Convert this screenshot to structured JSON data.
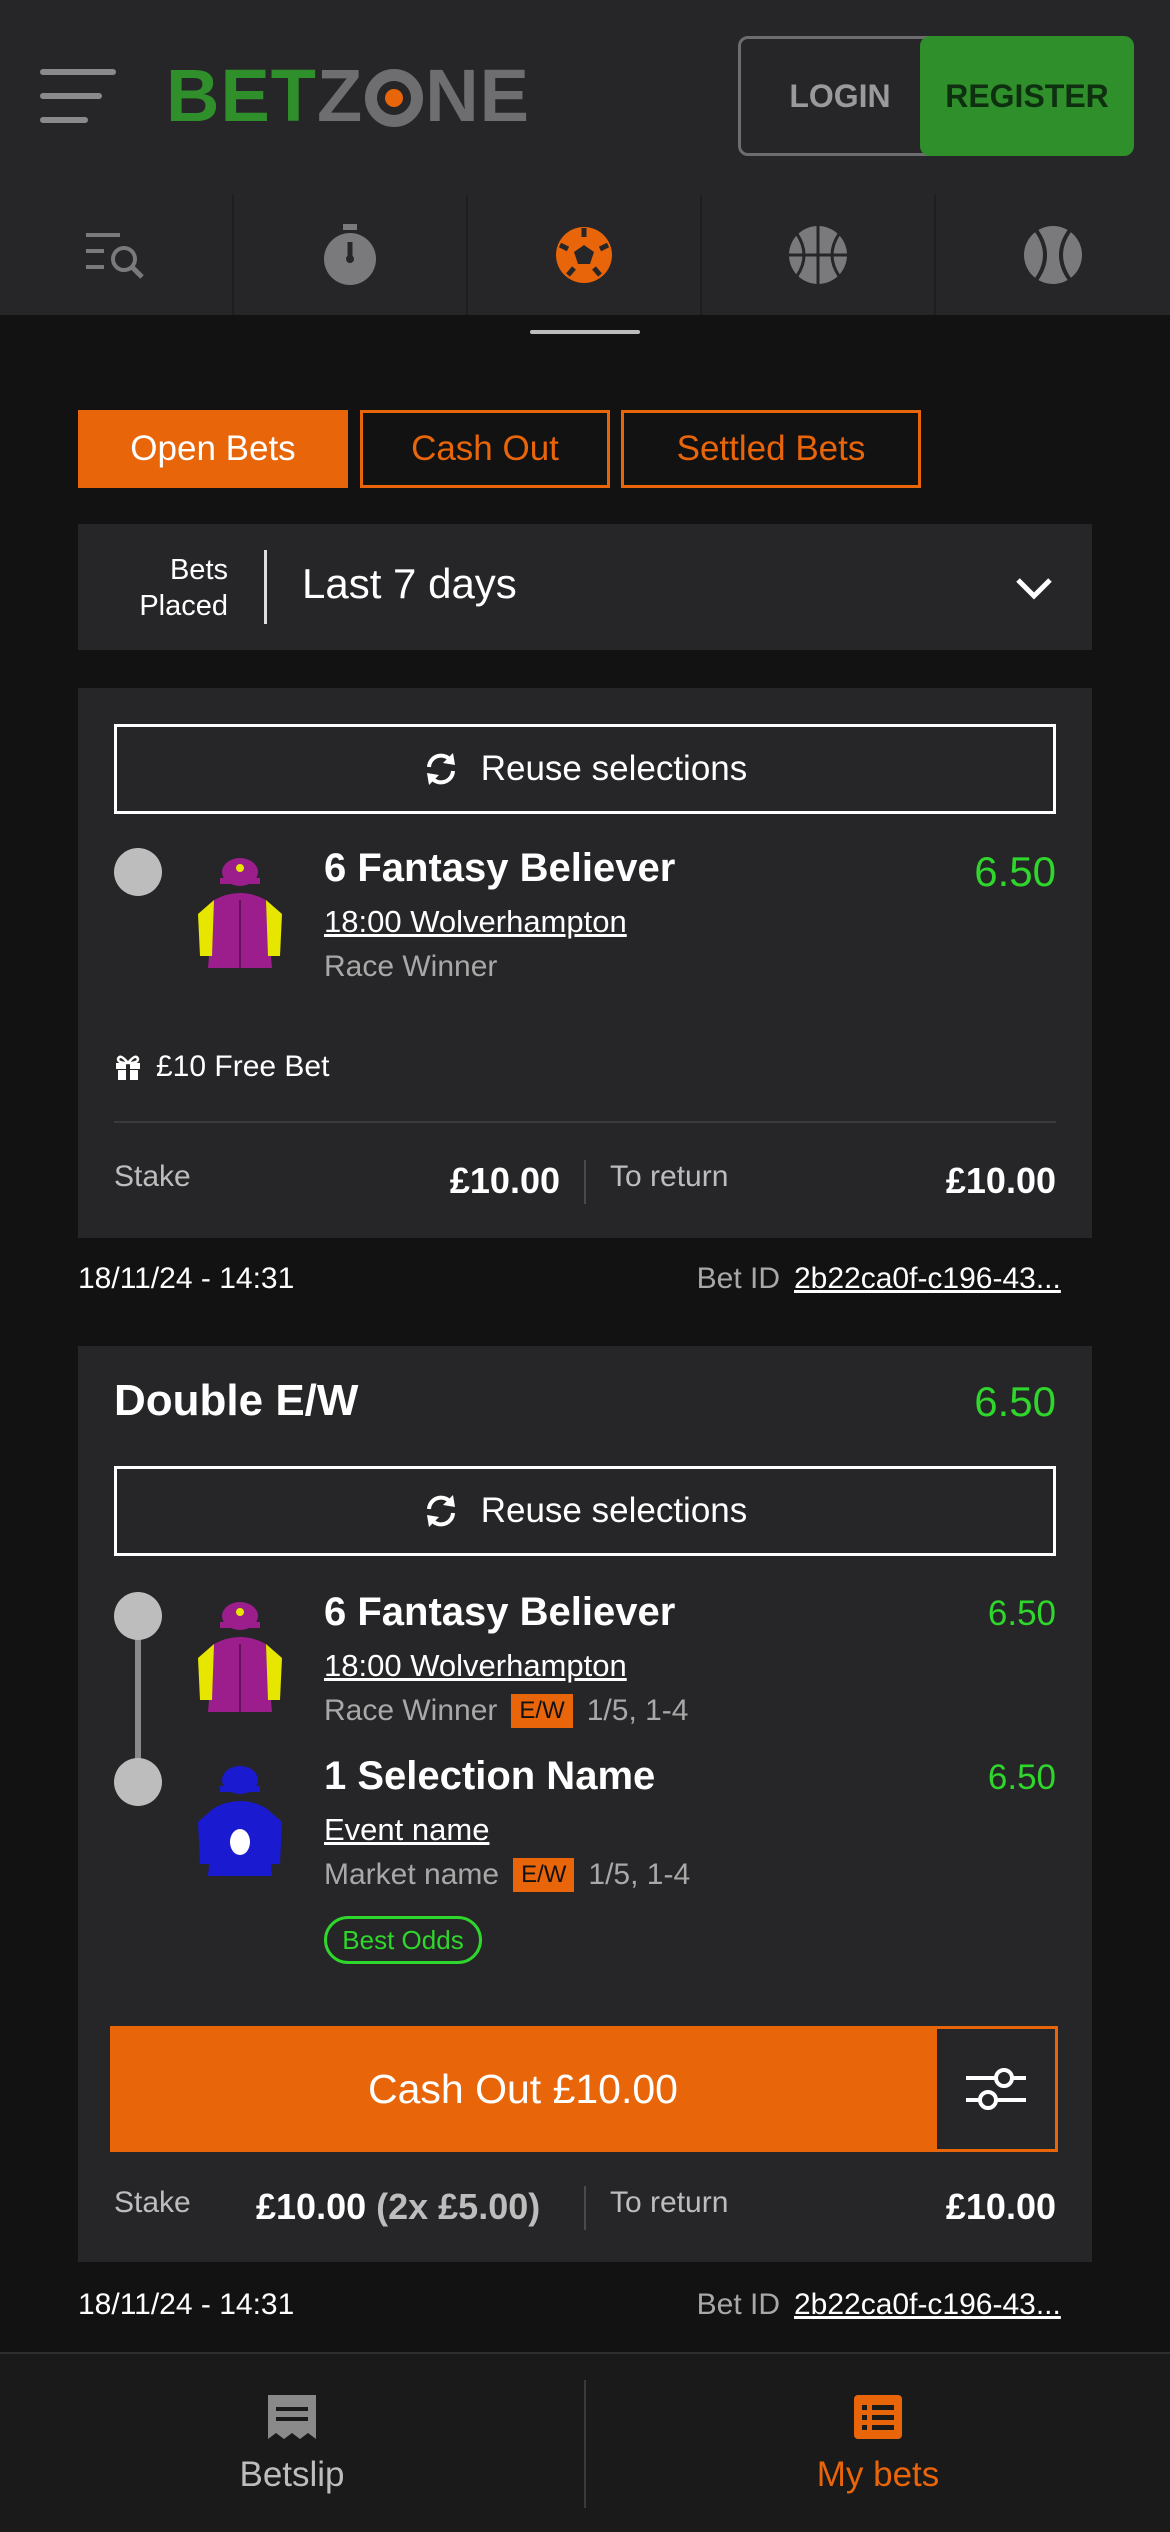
{
  "header": {
    "logo_bet": "BET",
    "logo_z": "Z",
    "logo_ne": "NE",
    "login_label": "LOGIN",
    "register_label": "REGISTER"
  },
  "sport_nav": {
    "items": [
      "search-menu-icon",
      "stopwatch-icon",
      "football-icon",
      "basketball-icon",
      "tennis-icon"
    ],
    "active_index": 2
  },
  "tabs": [
    {
      "label": "Open Bets",
      "active": true
    },
    {
      "label": "Cash Out",
      "active": false
    },
    {
      "label": "Settled Bets",
      "active": false
    }
  ],
  "filter": {
    "label_line1": "Bets",
    "label_line2": "Placed",
    "value": "Last 7 days"
  },
  "bet1": {
    "reuse_label": "Reuse selections",
    "selection": {
      "name": "6 Fantasy Believer",
      "event": "18:00 Wolverhampton",
      "market": "Race Winner",
      "odds": "6.50"
    },
    "free_bet": "£10 Free Bet",
    "stake_label": "Stake",
    "stake_value": "£10.00",
    "return_label": "To return",
    "return_value": "£10.00",
    "date": "18/11/24 - 14:31",
    "bet_id_label": "Bet ID",
    "bet_id": "2b22ca0f-c196-43..."
  },
  "bet2": {
    "title": "Double E/W",
    "title_odds": "6.50",
    "reuse_label": "Reuse selections",
    "selections": [
      {
        "name": "6 Fantasy Believer",
        "event": "18:00 Wolverhampton",
        "market": "Race Winner",
        "ew": "E/W",
        "terms": "1/5, 1-4",
        "odds": "6.50"
      },
      {
        "name": "1 Selection Name",
        "event": "Event name",
        "market": "Market name",
        "ew": "E/W",
        "terms": "1/5, 1-4",
        "odds": "6.50"
      }
    ],
    "best_odds": "Best Odds",
    "cashout_label": "Cash Out £10.00",
    "stake_label": "Stake",
    "stake_value": "£10.00",
    "stake_split": "(2x £5.00)",
    "return_label": "To return",
    "return_value": "£10.00",
    "date": "18/11/24 - 14:31",
    "bet_id_label": "Bet ID",
    "bet_id": "2b22ca0f-c196-43..."
  },
  "bottom_nav": [
    {
      "label": "Betslip",
      "icon": "receipt-icon",
      "active": false
    },
    {
      "label": "My bets",
      "icon": "list-icon",
      "active": true
    }
  ],
  "colors": {
    "accent": "#e8650a",
    "brand_green": "#2f8f2b",
    "odds_green": "#2fd62b",
    "surface": "#262628",
    "background": "#121212"
  }
}
